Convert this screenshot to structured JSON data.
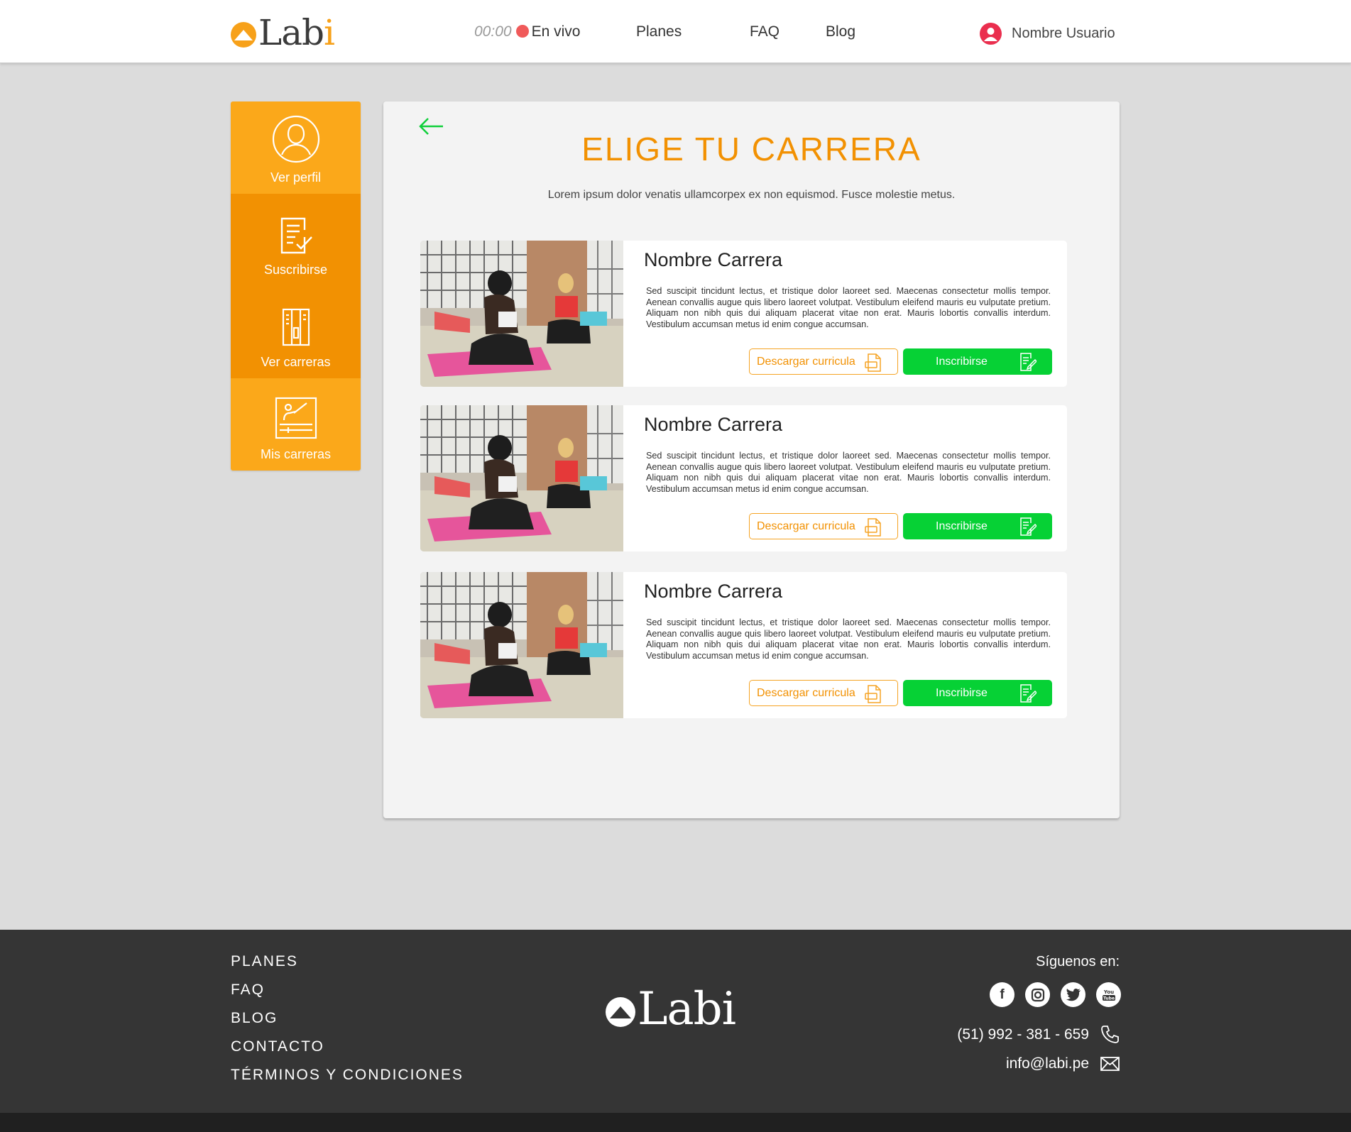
{
  "header": {
    "logo_main": "Lab",
    "logo_accent": "i",
    "timer": "00:00",
    "live_label": "En vivo",
    "nav": [
      "Planes",
      "FAQ",
      "Blog"
    ],
    "user_name": "Nombre Usuario"
  },
  "sidebar": [
    {
      "label": "Ver perfil",
      "icon": "profile-icon"
    },
    {
      "label": "Suscribirse",
      "icon": "subscribe-icon"
    },
    {
      "label": "Ver carreras",
      "icon": "brochure-icon"
    },
    {
      "label": "Mis carreras",
      "icon": "classroom-icon"
    }
  ],
  "main": {
    "title": "ELIGE TU CARRERA",
    "subtitle": "Lorem ipsum dolor venatis ullamcorpex ex non equismod. Fusce molestie metus.",
    "careers": [
      {
        "name": "Nombre Carrera",
        "description": "Sed suscipit tincidunt lectus, et tristique dolor laoreet sed. Maecenas consectetur mollis tempor. Aenean convallis augue quis libero laoreet volutpat. Vestibulum eleifend mauris eu vulputate pretium. Aliquam non nibh quis dui aliquam placerat vitae non erat. Mauris lobortis convallis interdum. Vestibulum accumsan metus id enim congue accumsan.",
        "download_label": "Descargar curricula",
        "enroll_label": "Inscribirse"
      },
      {
        "name": "Nombre Carrera",
        "description": "Sed suscipit tincidunt lectus, et tristique dolor laoreet sed. Maecenas consectetur mollis tempor. Aenean convallis augue quis libero laoreet volutpat. Vestibulum eleifend mauris eu vulputate pretium. Aliquam non nibh quis dui aliquam placerat vitae non erat. Mauris lobortis convallis interdum. Vestibulum accumsan metus id enim congue accumsan.",
        "download_label": "Descargar curricula",
        "enroll_label": "Inscribirse"
      },
      {
        "name": "Nombre Carrera",
        "description": "Sed suscipit tincidunt lectus, et tristique dolor laoreet sed. Maecenas consectetur mollis tempor. Aenean convallis augue quis libero laoreet volutpat. Vestibulum eleifend mauris eu vulputate pretium. Aliquam non nibh quis dui aliquam placerat vitae non erat. Mauris lobortis convallis interdum. Vestibulum accumsan metus id enim congue accumsan.",
        "download_label": "Descargar curricula",
        "enroll_label": "Inscribirse"
      }
    ]
  },
  "footer": {
    "links": [
      "PLANES",
      "FAQ",
      "BLOG",
      "CONTACTO",
      "TÉRMINOS Y CONDICIONES"
    ],
    "logo": "Labi",
    "follow_label": "Síguenos en:",
    "socials": [
      "facebook-icon",
      "instagram-icon",
      "twitter-icon",
      "youtube-icon"
    ],
    "phone": "(51) 992 - 381 - 659",
    "email": "info@labi.pe"
  },
  "colors": {
    "accent_orange": "#f29102",
    "sidebar_light": "#fba81a",
    "green": "#06d135",
    "live_red": "#f05a5a",
    "footer_bg": "#353535"
  }
}
